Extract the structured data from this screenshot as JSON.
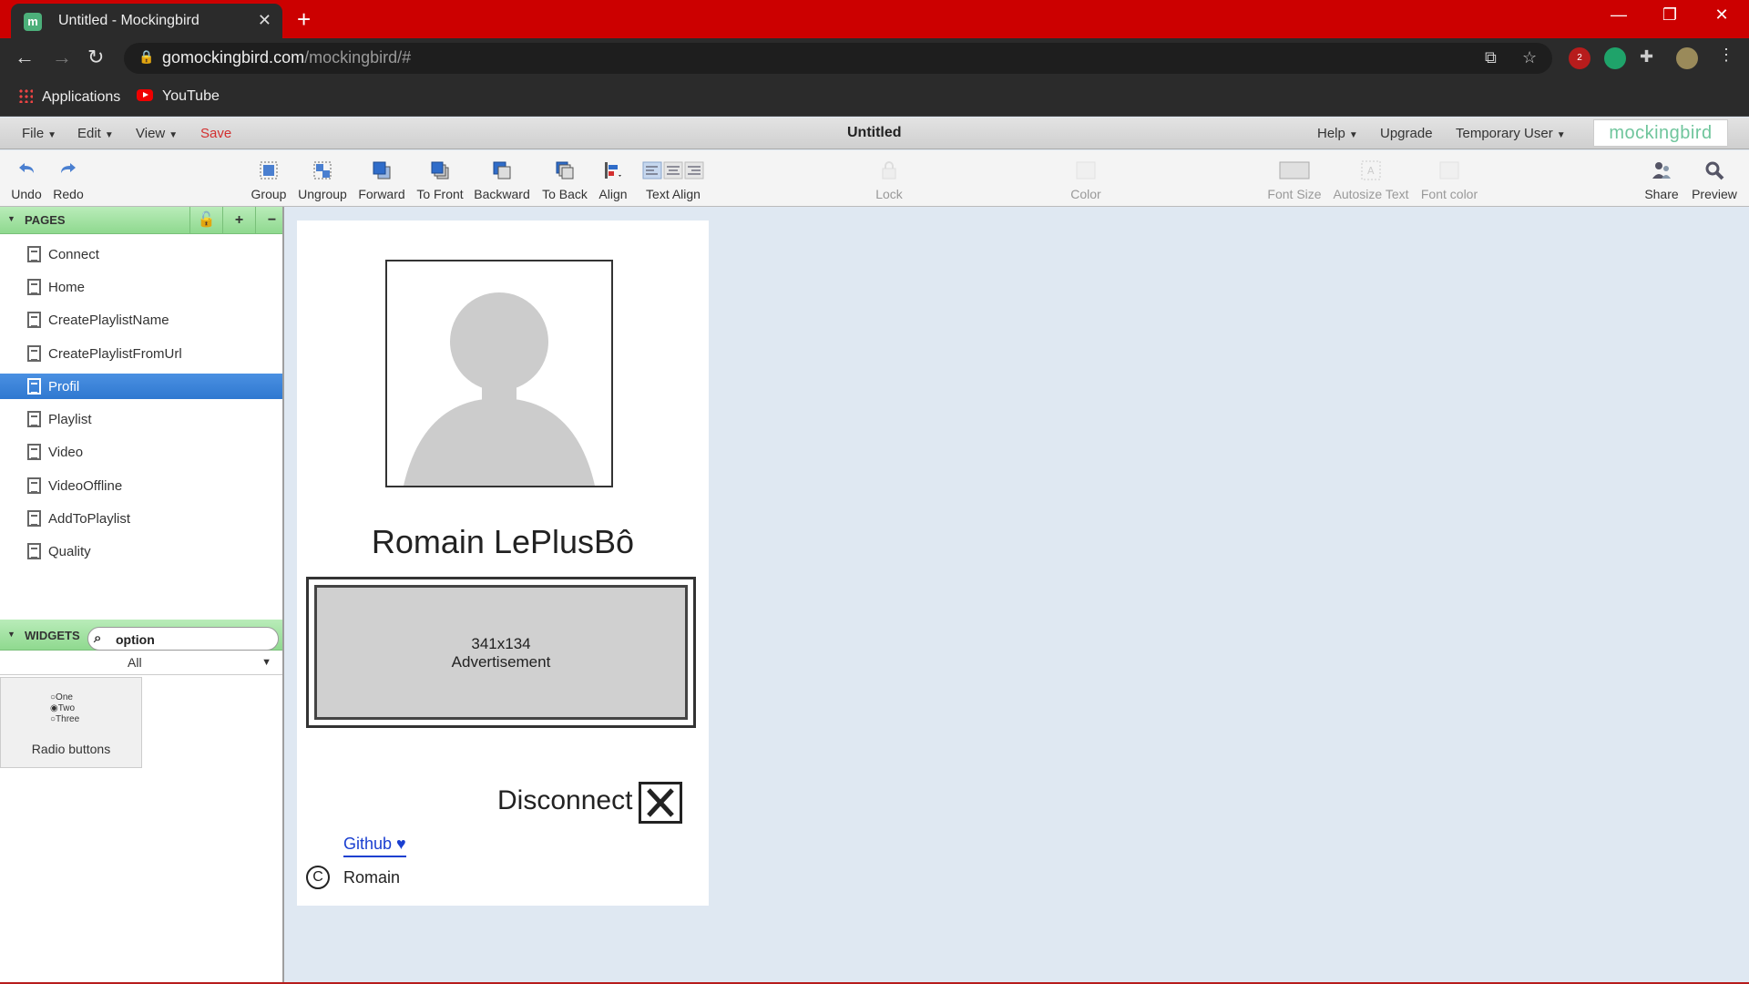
{
  "browser": {
    "tab_title": "Untitled - Mockingbird",
    "favicon_letter": "m",
    "url_host": "gomockingbird.com",
    "url_path": "/mockingbird/#",
    "extension_badge": "2",
    "bookmarks": [
      {
        "label": "Applications",
        "icon": "apps-grid-icon"
      },
      {
        "label": "YouTube",
        "icon": "youtube-icon"
      }
    ],
    "accent": "#cc0000"
  },
  "menubar": {
    "file": "File",
    "edit": "Edit",
    "view": "View",
    "save": "Save",
    "doc_title": "Untitled",
    "help": "Help",
    "upgrade": "Upgrade",
    "user": "Temporary User",
    "logo": "mockingbird"
  },
  "tools": {
    "undo": "Undo",
    "redo": "Redo",
    "group": "Group",
    "ungroup": "Ungroup",
    "forward": "Forward",
    "to_front": "To Front",
    "backward": "Backward",
    "to_back": "To Back",
    "align": "Align",
    "text_align": "Text Align",
    "lock": "Lock",
    "color": "Color",
    "font_size": "Font Size",
    "autosize_text": "Autosize Text",
    "font_color": "Font color",
    "share": "Share",
    "preview": "Preview"
  },
  "pages_panel": {
    "title": "PAGES",
    "pages": [
      {
        "label": "Connect",
        "selected": false
      },
      {
        "label": "Home",
        "selected": false
      },
      {
        "label": "CreatePlaylistName",
        "selected": false
      },
      {
        "label": "CreatePlaylistFromUrl",
        "selected": false
      },
      {
        "label": "Profil",
        "selected": true
      },
      {
        "label": "Playlist",
        "selected": false
      },
      {
        "label": "Video",
        "selected": false
      },
      {
        "label": "VideoOffline",
        "selected": false
      },
      {
        "label": "AddToPlaylist",
        "selected": false
      },
      {
        "label": "Quality",
        "selected": false
      }
    ]
  },
  "widgets_panel": {
    "title": "WIDGETS",
    "search_value": "option",
    "filter": "All",
    "widget": {
      "options": [
        "One",
        "Two",
        "Three"
      ],
      "selected": "Two",
      "caption": "Radio buttons"
    }
  },
  "canvas": {
    "username": "Romain LePlusBô",
    "ad_size": "341x134",
    "ad_label": "Advertisement",
    "disconnect": "Disconnect",
    "github": "Github ♥",
    "copyright_symbol": "C",
    "copyright_name": "Romain"
  }
}
